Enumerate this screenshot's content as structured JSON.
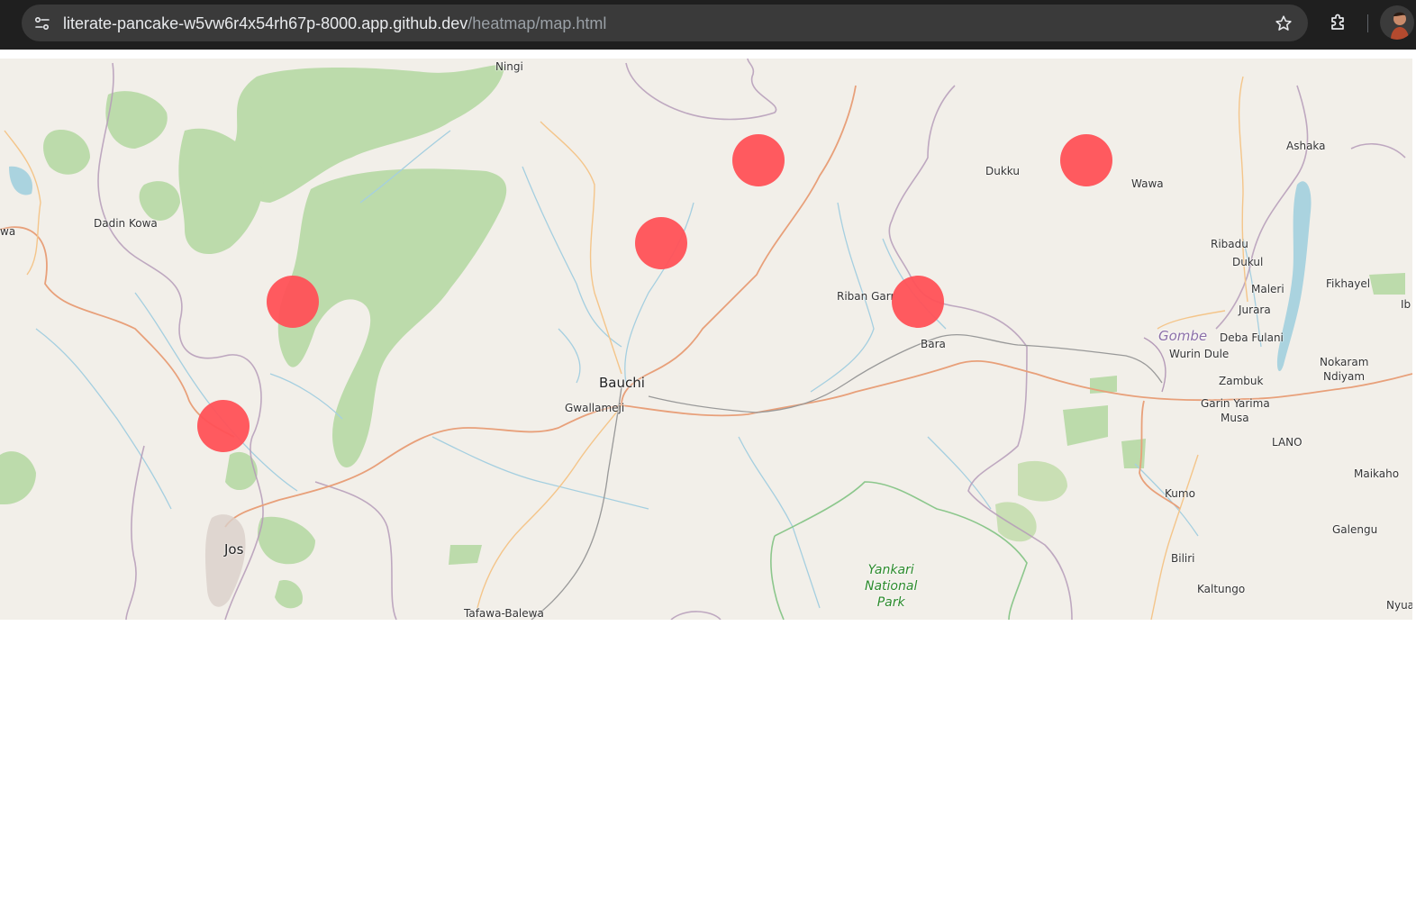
{
  "browser": {
    "url_host": "literate-pancake-w5vw6r4x54rh67p-8000.app.github.dev",
    "url_path": "/heatmap/map.html"
  },
  "map": {
    "labels": {
      "ningi": "Ningi",
      "dadin_kowa": "Dadin Kowa",
      "wa": "wa",
      "dukku": "Dukku",
      "wawa": "Wawa",
      "ashaka": "Ashaka",
      "ribadu": "Ribadu",
      "dukul": "Dukul",
      "fikhayel": "Fikhayel",
      "ib": "Ib",
      "maleri": "Maleri",
      "jurara": "Jurara",
      "riban_garr": "Riban Garr",
      "bara": "Bara",
      "gombe": "Gombe",
      "deba_fulani": "Deba Fulani",
      "wurin_dule": "Wurin Dule",
      "nokaram": "Nokaram",
      "ndiyam": "Ndiyam",
      "zambuk": "Zambuk",
      "garin_yarima": "Garin Yarima",
      "musa": "Musa",
      "lano": "LANO",
      "bauchi": "Bauchi",
      "gwallameji": "Gwallameji",
      "maikaho": "Maikaho",
      "kumo": "Kumo",
      "galengu": "Galengu",
      "jos": "Jos",
      "yankari_1": "Yankari",
      "yankari_2": "National",
      "yankari_3": "Park",
      "biliri": "Biliri",
      "kaltungo": "Kaltungo",
      "tafawa_balewa": "Tafawa-Balewa",
      "nyua": "Nyua"
    },
    "marker_color": "#ff5157",
    "marker_count": 6
  }
}
